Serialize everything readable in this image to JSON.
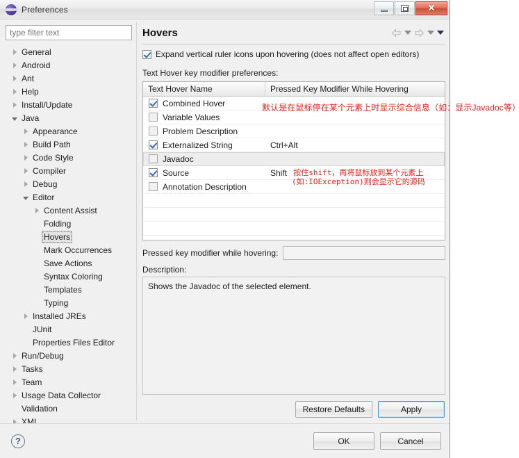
{
  "window": {
    "title": "Preferences",
    "icon": "eclipse-icon",
    "buttons": {
      "minimize": "minimize-button",
      "maximize": "restore-button",
      "close": "✕"
    }
  },
  "sidebar": {
    "filter": {
      "placeholder": "type filter text",
      "value": ""
    },
    "items": [
      {
        "label": "General",
        "indent": 0,
        "state": "collapsed"
      },
      {
        "label": "Android",
        "indent": 0,
        "state": "collapsed"
      },
      {
        "label": "Ant",
        "indent": 0,
        "state": "collapsed"
      },
      {
        "label": "Help",
        "indent": 0,
        "state": "collapsed"
      },
      {
        "label": "Install/Update",
        "indent": 0,
        "state": "collapsed"
      },
      {
        "label": "Java",
        "indent": 0,
        "state": "expanded"
      },
      {
        "label": "Appearance",
        "indent": 1,
        "state": "collapsed"
      },
      {
        "label": "Build Path",
        "indent": 1,
        "state": "collapsed"
      },
      {
        "label": "Code Style",
        "indent": 1,
        "state": "collapsed"
      },
      {
        "label": "Compiler",
        "indent": 1,
        "state": "collapsed"
      },
      {
        "label": "Debug",
        "indent": 1,
        "state": "collapsed"
      },
      {
        "label": "Editor",
        "indent": 1,
        "state": "expanded"
      },
      {
        "label": "Content Assist",
        "indent": 2,
        "state": "collapsed"
      },
      {
        "label": "Folding",
        "indent": 2,
        "state": "leaf"
      },
      {
        "label": "Hovers",
        "indent": 2,
        "state": "leaf",
        "selected": true
      },
      {
        "label": "Mark Occurrences",
        "indent": 2,
        "state": "leaf"
      },
      {
        "label": "Save Actions",
        "indent": 2,
        "state": "leaf"
      },
      {
        "label": "Syntax Coloring",
        "indent": 2,
        "state": "leaf"
      },
      {
        "label": "Templates",
        "indent": 2,
        "state": "leaf"
      },
      {
        "label": "Typing",
        "indent": 2,
        "state": "leaf"
      },
      {
        "label": "Installed JREs",
        "indent": 1,
        "state": "collapsed"
      },
      {
        "label": "JUnit",
        "indent": 1,
        "state": "leaf"
      },
      {
        "label": "Properties Files Editor",
        "indent": 1,
        "state": "leaf"
      },
      {
        "label": "Run/Debug",
        "indent": 0,
        "state": "collapsed"
      },
      {
        "label": "Tasks",
        "indent": 0,
        "state": "collapsed"
      },
      {
        "label": "Team",
        "indent": 0,
        "state": "collapsed"
      },
      {
        "label": "Usage Data Collector",
        "indent": 0,
        "state": "collapsed"
      },
      {
        "label": "Validation",
        "indent": 0,
        "state": "leaf"
      },
      {
        "label": "XML",
        "indent": 0,
        "state": "collapsed"
      }
    ]
  },
  "page": {
    "title": "Hovers",
    "nav": {
      "back": "back-arrow-icon",
      "back_menu": "back-dropdown-icon",
      "forward": "forward-arrow-icon",
      "forward_menu": "forward-dropdown-icon",
      "menu": "view-menu-icon"
    },
    "expand_ruler": {
      "label": "Expand vertical ruler icons upon hovering (does not affect open editors)",
      "checked": true
    },
    "section_label": "Text Hover key modifier preferences:",
    "table": {
      "columns": [
        "Text Hover Name",
        "Pressed Key Modifier While Hovering"
      ],
      "rows": [
        {
          "name": "Combined Hover",
          "checked": true,
          "modifier": "",
          "selected": false
        },
        {
          "name": "Variable Values",
          "checked": false,
          "modifier": "",
          "selected": false
        },
        {
          "name": "Problem Description",
          "checked": false,
          "modifier": "",
          "selected": false
        },
        {
          "name": "Externalized String",
          "checked": true,
          "modifier": "Ctrl+Alt",
          "selected": false
        },
        {
          "name": "Javadoc",
          "checked": false,
          "modifier": "",
          "selected": true
        },
        {
          "name": "Source",
          "checked": true,
          "modifier": "Shift",
          "selected": false
        },
        {
          "name": "Annotation Description",
          "checked": false,
          "modifier": "",
          "selected": false
        }
      ],
      "empty_rows": 3
    },
    "modifier_field": {
      "label": "Pressed key modifier while hovering:",
      "value": ""
    },
    "description": {
      "label": "Description:",
      "text": "Shows the Javadoc of the selected element."
    },
    "restore_defaults": "Restore Defaults",
    "apply": "Apply"
  },
  "footer": {
    "help": "?",
    "ok": "OK",
    "cancel": "Cancel"
  },
  "annotations": {
    "combined_hover_note": "默认是在鼠标停在某个元素上时显示综合信息（如：显示Javadoc等）",
    "source_note_line1": "按住shift，再将鼠标放到某个元素上",
    "source_note_line2": "(如:IOException)则会显示它的源码",
    "color": "#e8201a"
  }
}
